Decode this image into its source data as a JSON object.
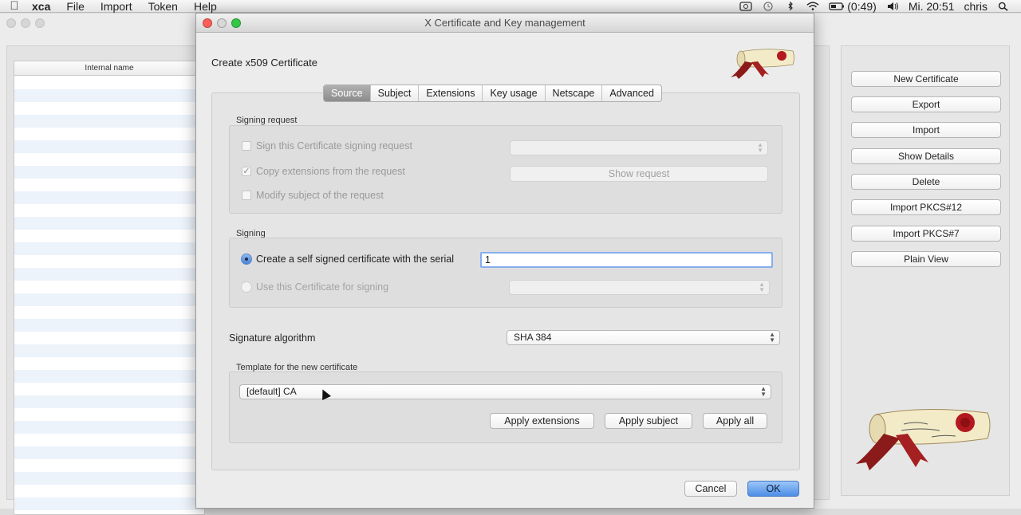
{
  "menubar": {
    "apple_icon": "apple-logo-icon",
    "app_name": "xca",
    "items": [
      "File",
      "Import",
      "Token",
      "Help"
    ],
    "battery_text": "(0:49)",
    "clock": "Mi. 20:51",
    "user": "chris"
  },
  "main_window": {
    "list_header": "Internal name",
    "buttons": [
      "New Certificate",
      "Export",
      "Import",
      "Show Details",
      "Delete",
      "Import PKCS#12",
      "Import PKCS#7",
      "Plain View"
    ]
  },
  "dialog": {
    "title": "X Certificate and Key management",
    "heading": "Create x509 Certificate",
    "tabs": [
      "Source",
      "Subject",
      "Extensions",
      "Key usage",
      "Netscape",
      "Advanced"
    ],
    "active_tab": "Source",
    "signing_request": {
      "title": "Signing request",
      "sign_csr_label": "Sign this Certificate signing request",
      "copy_ext_label": "Copy extensions from the request",
      "modify_subject_label": "Modify subject of the request",
      "show_request_label": "Show request",
      "copy_ext_checked": "✓"
    },
    "signing": {
      "title": "Signing",
      "self_signed_label": "Create a self signed certificate with the serial",
      "serial_value": "1",
      "use_cert_label": "Use this Certificate for signing"
    },
    "signature_algorithm": {
      "label": "Signature algorithm",
      "value": "SHA 384"
    },
    "template": {
      "title": "Template for the new certificate",
      "value": "[default] CA",
      "apply_extensions": "Apply extensions",
      "apply_subject": "Apply subject",
      "apply_all": "Apply all"
    },
    "cancel_label": "Cancel",
    "ok_label": "OK"
  },
  "colors": {
    "close": "#fc5f57",
    "minimize": "#fdbc2e",
    "zoom": "#33c748",
    "accent": "#4d8ee6"
  }
}
